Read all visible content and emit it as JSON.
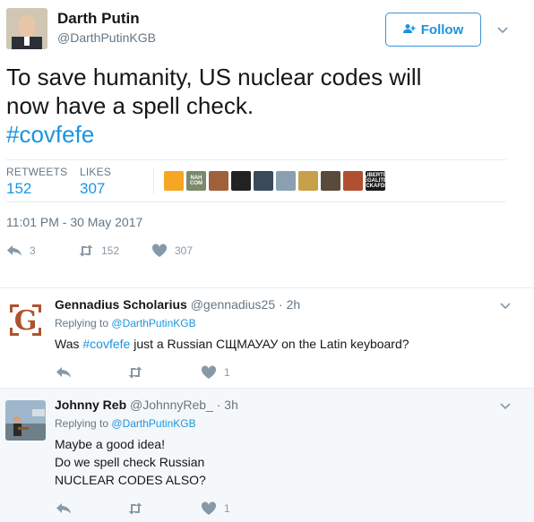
{
  "tweet": {
    "author_name": "Darth Putin",
    "author_handle": "@DarthPutinKGB",
    "follow_label": "Follow",
    "text_line1": "To save humanity, US nuclear codes will",
    "text_line2": "now have a spell check.",
    "hashtag": "#covfefe",
    "retweets_label": "RETWEETS",
    "retweets_count": "152",
    "likes_label": "LIKES",
    "likes_count": "307",
    "timestamp": "11:01 PM - 30 May 2017",
    "actions": {
      "reply_count": "3",
      "retweet_count": "152",
      "like_count": "307"
    },
    "liker_avatars": [
      {
        "color": "#f5a623",
        "label": ""
      },
      {
        "color": "#7a8a6b",
        "label": "NAH COM"
      },
      {
        "color": "#a0603a",
        "label": ""
      },
      {
        "color": "#222222",
        "label": ""
      },
      {
        "color": "#3a4a5a",
        "label": ""
      },
      {
        "color": "#8aa0b0",
        "label": ""
      },
      {
        "color": "#c7a04a",
        "label": ""
      },
      {
        "color": "#5a4a3a",
        "label": ""
      },
      {
        "color": "#b05030",
        "label": ""
      },
      {
        "color": "#1a1a1a",
        "label": "LIBERTÉ ÉGALITÉ FCKAFDE"
      }
    ]
  },
  "replies": [
    {
      "name": "Gennadius Scholarius",
      "handle": "@gennadius25",
      "time": "· 2h",
      "replying_prefix": "Replying to",
      "replying_to": "@DarthPutinKGB",
      "text_before": "Was ",
      "hashtag": "#covfefe",
      "text_after": " just a Russian СЩМАУАУ on the Latin keyboard?",
      "like_count": "1"
    },
    {
      "name": "Johnny Reb",
      "handle": "@JohnnyReb_",
      "time": "· 3h",
      "replying_prefix": "Replying to",
      "replying_to": "@DarthPutinKGB",
      "line1": "Maybe a good idea!",
      "line2": "Do we spell check Russian",
      "line3": "NUCLEAR CODES ALSO?",
      "like_count": "1"
    }
  ],
  "colors": {
    "accent": "#1b95e0",
    "muted": "#657786",
    "icon": "#8899a6"
  }
}
